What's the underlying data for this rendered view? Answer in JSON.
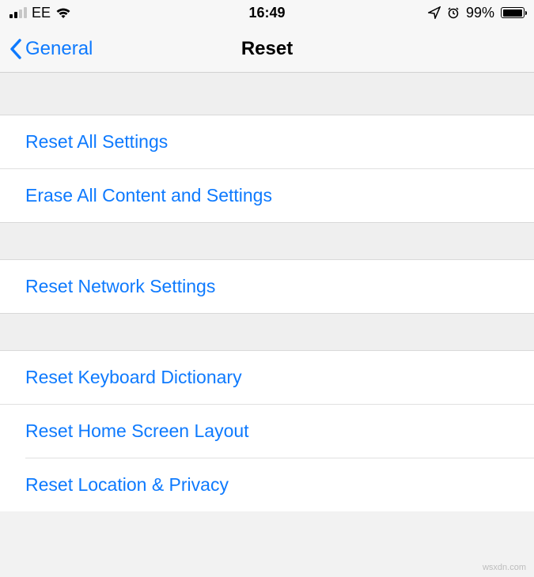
{
  "statusBar": {
    "carrier": "EE",
    "time": "16:49",
    "batteryPercent": "99%"
  },
  "nav": {
    "back": "General",
    "title": "Reset"
  },
  "sections": [
    {
      "items": [
        {
          "label": "Reset All Settings"
        },
        {
          "label": "Erase All Content and Settings"
        }
      ]
    },
    {
      "items": [
        {
          "label": "Reset Network Settings"
        }
      ]
    },
    {
      "items": [
        {
          "label": "Reset Keyboard Dictionary"
        },
        {
          "label": "Reset Home Screen Layout"
        },
        {
          "label": "Reset Location & Privacy"
        }
      ]
    }
  ],
  "watermark": "wsxdn.com"
}
